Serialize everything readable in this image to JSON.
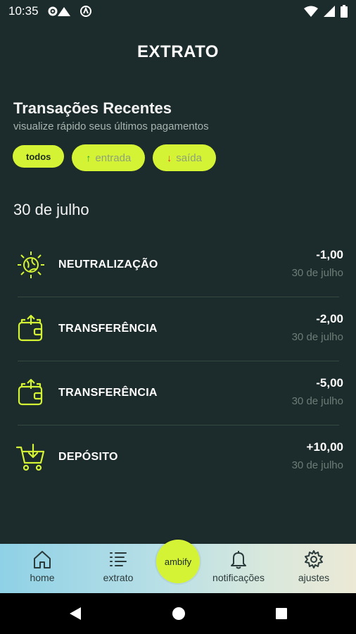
{
  "status_bar": {
    "time": "10:35",
    "icons_left": [
      "settings-icon",
      "warning-icon",
      "circle-a-icon"
    ],
    "icons_right": [
      "wifi-icon",
      "signal-icon",
      "battery-icon"
    ]
  },
  "header": {
    "title": "EXTRATO"
  },
  "section": {
    "title": "Transações Recentes",
    "subtitle": "visualize rápido seus últimos pagamentos"
  },
  "filters": [
    {
      "label": "todos",
      "active": true
    },
    {
      "label": "entrada",
      "arrow": "↑",
      "arrow_color": "#1aa33a"
    },
    {
      "label": "saída",
      "arrow": "↓",
      "arrow_color": "#e23a2a"
    }
  ],
  "date_group": {
    "label": "30 de julho"
  },
  "transactions": [
    {
      "name": "NEUTRALIZAÇÃO",
      "amount": "-1,00",
      "date": "30 de julho",
      "icon": "globe-sun-icon"
    },
    {
      "name": "TRANSFERÊNCIA",
      "amount": "-2,00",
      "date": "30 de julho",
      "icon": "wallet-out-icon"
    },
    {
      "name": "TRANSFERÊNCIA",
      "amount": "-5,00",
      "date": "30 de julho",
      "icon": "wallet-out-icon"
    },
    {
      "name": "DEPÓSITO",
      "amount": "+10,00",
      "date": "30 de julho",
      "icon": "cart-download-icon"
    }
  ],
  "bottom_nav": {
    "home": "home",
    "extrato": "extrato",
    "center": "ambify",
    "notificacoes": "notificações",
    "ajustes": "ajustes"
  },
  "colors": {
    "background": "#1c2b2b",
    "accent": "#d4f335",
    "muted_text": "#6c7d76"
  }
}
